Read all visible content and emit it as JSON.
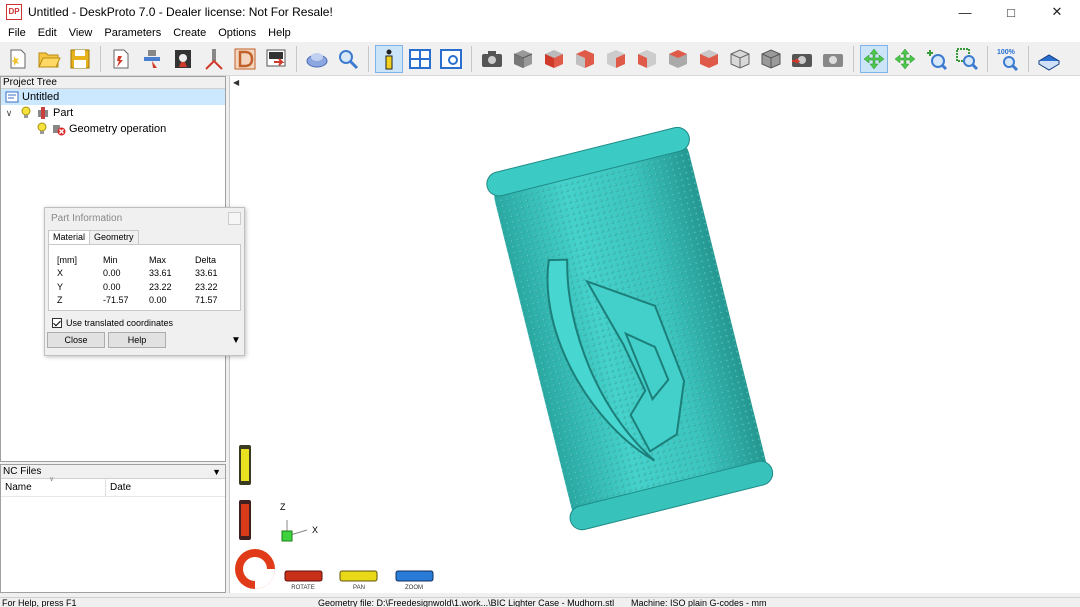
{
  "window": {
    "title": "Untitled - DeskProto 7.0 - Dealer license: Not For Resale!",
    "icon_text": "DP",
    "controls": [
      "minimize-icon",
      "maximize-icon",
      "close-icon"
    ]
  },
  "menu": [
    "File",
    "Edit",
    "View",
    "Parameters",
    "Create",
    "Options",
    "Help"
  ],
  "toolbar": {
    "zoom_label": "100%"
  },
  "project_tree": {
    "header": "Project Tree",
    "root": "Untitled",
    "part": "Part",
    "operation": "Geometry operation"
  },
  "nc_files": {
    "header": "NC Files",
    "columns": [
      "Name",
      "Date"
    ]
  },
  "part_info": {
    "title": "Part Information",
    "tabs": [
      "Material",
      "Geometry"
    ],
    "headers": [
      "[mm]",
      "Min",
      "Max",
      "Delta"
    ],
    "rows": [
      [
        "X",
        "0.00",
        "33.61",
        "33.61"
      ],
      [
        "Y",
        "0.00",
        "23.22",
        "23.22"
      ],
      [
        "Z",
        "-71.57",
        "0.00",
        "71.57"
      ]
    ],
    "checkbox_label": "Use translated coordinates",
    "checked": true,
    "close": "Close",
    "help": "Help"
  },
  "viewport": {
    "axis_z": "Z",
    "axis_x": "X",
    "controls": [
      "ROTATE",
      "PAN",
      "ZOOM"
    ],
    "model_color": "#3ec6c0"
  },
  "status": {
    "help": "For Help, press F1",
    "geometry": "Geometry file: D:\\Freedesignwold\\1.work...\\BIC Lighter Case - Mudhorn.stl",
    "machine": "Machine: ISO plain G-codes - mm"
  }
}
